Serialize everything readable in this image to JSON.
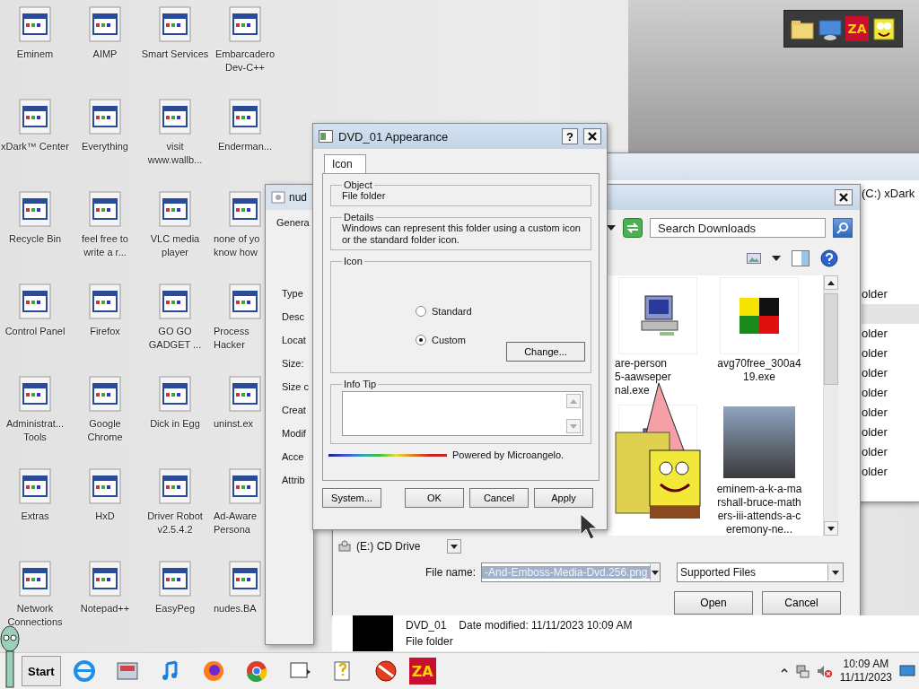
{
  "desktop_icons": [
    {
      "label": "Eminem"
    },
    {
      "label": "AIMP"
    },
    {
      "label": "Smart Services"
    },
    {
      "label": "Embarcadero Dev-C++"
    },
    {
      "label": "xDark™ Center"
    },
    {
      "label": "Everything"
    },
    {
      "label": "visit www.wallb..."
    },
    {
      "label": "Enderman..."
    },
    {
      "label": "Recycle Bin"
    },
    {
      "label": "feel free to write a r..."
    },
    {
      "label": "VLC media player"
    },
    {
      "label": "none of yo know how"
    },
    {
      "label": "Control Panel"
    },
    {
      "label": "Firefox"
    },
    {
      "label": "GO GO GADGET ..."
    },
    {
      "label": "Process Hacker"
    },
    {
      "label": "Administrat... Tools"
    },
    {
      "label": "Google Chrome"
    },
    {
      "label": "Dick in Egg"
    },
    {
      "label": "uninst.ex"
    },
    {
      "label": "Extras"
    },
    {
      "label": "HxD"
    },
    {
      "label": "Driver Robot v2.5.4.2"
    },
    {
      "label": "Ad-Aware Persona"
    },
    {
      "label": "Network Connections"
    },
    {
      "label": "Notepad++"
    },
    {
      "label": "EasyPeg"
    },
    {
      "label": "nudes.BA"
    }
  ],
  "top_toolbar": {
    "items": [
      {
        "kind": "folder"
      },
      {
        "kind": "screen"
      },
      {
        "kind": "za",
        "text": "ZA"
      },
      {
        "kind": "cartoon"
      }
    ]
  },
  "explorer_window": {
    "address": "(C:) xDark",
    "rows": [
      {
        "text": "older",
        "selected": false
      },
      {
        "selected": true
      },
      {
        "text": "older",
        "selected": false
      },
      {
        "text": "older",
        "selected": false
      },
      {
        "text": "older",
        "selected": false
      },
      {
        "text": "older",
        "selected": false
      },
      {
        "text": "older",
        "selected": false
      },
      {
        "text": "older",
        "selected": false
      },
      {
        "text": "older",
        "selected": false
      },
      {
        "text": "older",
        "selected": false
      }
    ]
  },
  "properties_window": {
    "title": "nud",
    "tab": "Genera",
    "fields": [
      "Type",
      "Desc",
      "Locat",
      "Size:",
      "Size c",
      "Creat",
      "Modif",
      "Acce",
      "Attrib"
    ]
  },
  "open_dialog": {
    "search_placeholder": "Search Downloads",
    "files": [
      {
        "kind": "program",
        "name": "are-person\n5-aawseper\nnal.exe"
      },
      {
        "kind": "image",
        "name": "avg70free_300a419.exe"
      },
      {
        "kind": "computer"
      },
      {
        "kind": "photo",
        "name": "eminem-a-k-a-marshall-bruce-mathers-iii-attends-a-ceremony-ne..."
      }
    ],
    "drive": "(E:) CD Drive",
    "file_name_label": "File name:",
    "file_name": "-And-Emboss-Media-Dvd.256.png",
    "filter": "Supported Files",
    "buttons": [
      "Open",
      "Cancel"
    ]
  },
  "details_pane": {
    "name": "DVD_01",
    "date_label": "Date modified:",
    "date": "11/11/2023 10:09 AM",
    "type": "File folder"
  },
  "appearance_dialog": {
    "title": "DVD_01 Appearance",
    "help": "?",
    "tabs": [
      {
        "label": "Icon",
        "selected": true
      }
    ],
    "object": {
      "legend": "Object",
      "text": "File folder"
    },
    "details": {
      "legend": "Details",
      "text": "Windows can represent this folder using a custom icon or the standard folder icon."
    },
    "icon_group": {
      "legend": "Icon",
      "options": [
        {
          "label": "Standard",
          "selected": false
        },
        {
          "label": "Custom",
          "selected": true
        }
      ],
      "change_button": "Change..."
    },
    "info_tip": {
      "legend": "Info Tip"
    },
    "powered_by": "Powered by Microangelo.",
    "buttons": [
      "System...",
      "OK",
      "Cancel",
      "Apply"
    ]
  },
  "taskbar": {
    "start": "Start",
    "items": [
      {
        "kind": "browser"
      },
      {
        "kind": "tool"
      },
      {
        "kind": "music"
      },
      {
        "kind": "firefox"
      },
      {
        "kind": "chrome"
      },
      {
        "kind": "window"
      },
      {
        "kind": "help"
      },
      {
        "kind": "blocked"
      },
      {
        "kind": "za",
        "text": "ZA"
      }
    ],
    "time": "10:09 AM",
    "date": "11/11/2023"
  }
}
